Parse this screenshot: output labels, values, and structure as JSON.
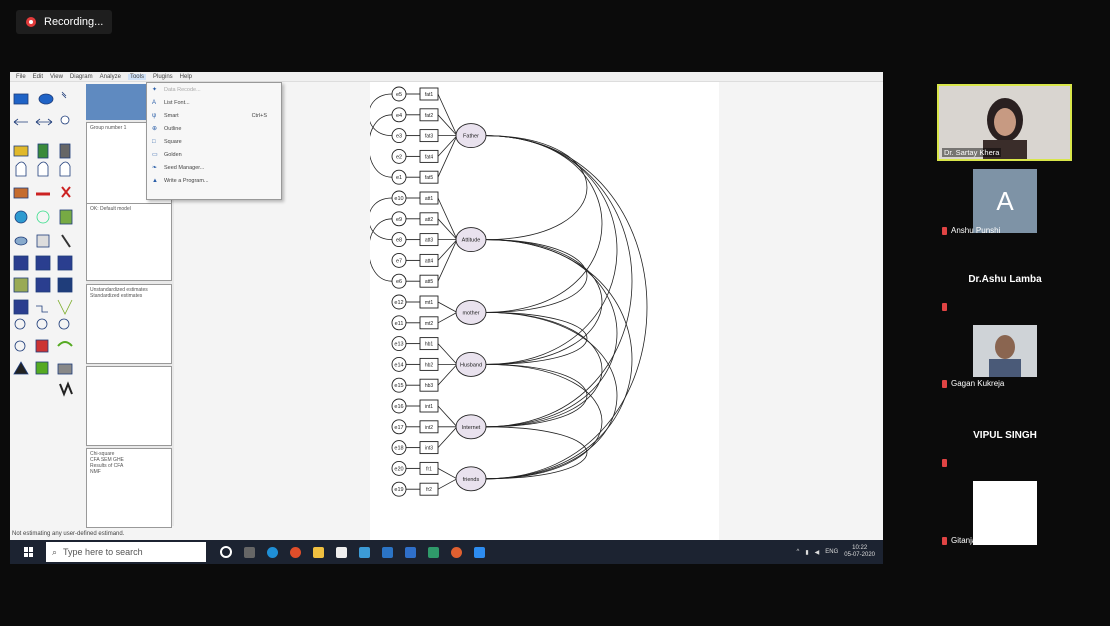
{
  "recording": {
    "label": "Recording..."
  },
  "menu": [
    "File",
    "Edit",
    "View",
    "Diagram",
    "Analyze",
    "Tools",
    "Plugins",
    "Help"
  ],
  "tools_dropdown": [
    {
      "label": "Data Recode...",
      "icon": "wand-icon",
      "enabled": false
    },
    {
      "label": "List Font...",
      "icon": "font-icon",
      "enabled": true
    },
    {
      "label": "Smart",
      "icon": "smart-icon",
      "shortcut": "Ctrl+S",
      "enabled": true
    },
    {
      "label": "Outline",
      "icon": "outline-icon",
      "enabled": true
    },
    {
      "label": "Square",
      "icon": "square-icon",
      "enabled": true
    },
    {
      "label": "Golden",
      "icon": "golden-icon",
      "enabled": true
    },
    {
      "label": "Seed Manager...",
      "icon": "seed-icon",
      "enabled": true
    },
    {
      "label": "Write a Program...",
      "icon": "program-icon",
      "enabled": true
    }
  ],
  "panels": [
    {
      "text": "Group number 1"
    },
    {
      "text": "OK: Default model"
    },
    {
      "text": "Unstandardized estimates\nStandardized estimates"
    },
    {
      "text": ""
    },
    {
      "text": "Chi-square\nCFA SEM GHE\nResults of CFA\nNMF"
    }
  ],
  "status": "Not estimating any user-defined estimand.",
  "diagram": {
    "latents": [
      "Father",
      "Attitude",
      "mother",
      "Husband",
      "Internet",
      "friends"
    ],
    "observed": [
      "fat1",
      "fat2",
      "fat3",
      "fat4",
      "fat5",
      "att1",
      "att2",
      "att3",
      "att4",
      "att5",
      "mt1",
      "mt2",
      "hb1",
      "hb2",
      "hb3",
      "int1",
      "int2",
      "int3",
      "fr1",
      "fr2"
    ],
    "errors": [
      "e5",
      "e4",
      "e3",
      "e2",
      "e1",
      "e10",
      "e9",
      "e8",
      "e7",
      "e6",
      "e12",
      "e11",
      "e13",
      "e14",
      "e15",
      "e16",
      "e17",
      "e18",
      "e20",
      "e19"
    ]
  },
  "taskbar": {
    "search_placeholder": "Type here to search",
    "lang": "ENG",
    "time": "10:22",
    "date": "05-07-2020"
  },
  "participants": [
    {
      "name": "Dr. Sartay Khera",
      "type": "video"
    },
    {
      "name": "Anshu Punshi",
      "type": "avatar",
      "initial": "A"
    },
    {
      "name": "Dr.Ashu Lamba",
      "type": "name-only"
    },
    {
      "name": "Gagan Kukreja",
      "type": "video"
    },
    {
      "name": "VIPUL SINGH",
      "type": "name-only"
    },
    {
      "name": "Gitanjali Singh",
      "type": "video"
    }
  ],
  "colors": {
    "accent_border": "#d9e64a",
    "mic_off": "#e04444",
    "taskbar": "#1c2331"
  }
}
